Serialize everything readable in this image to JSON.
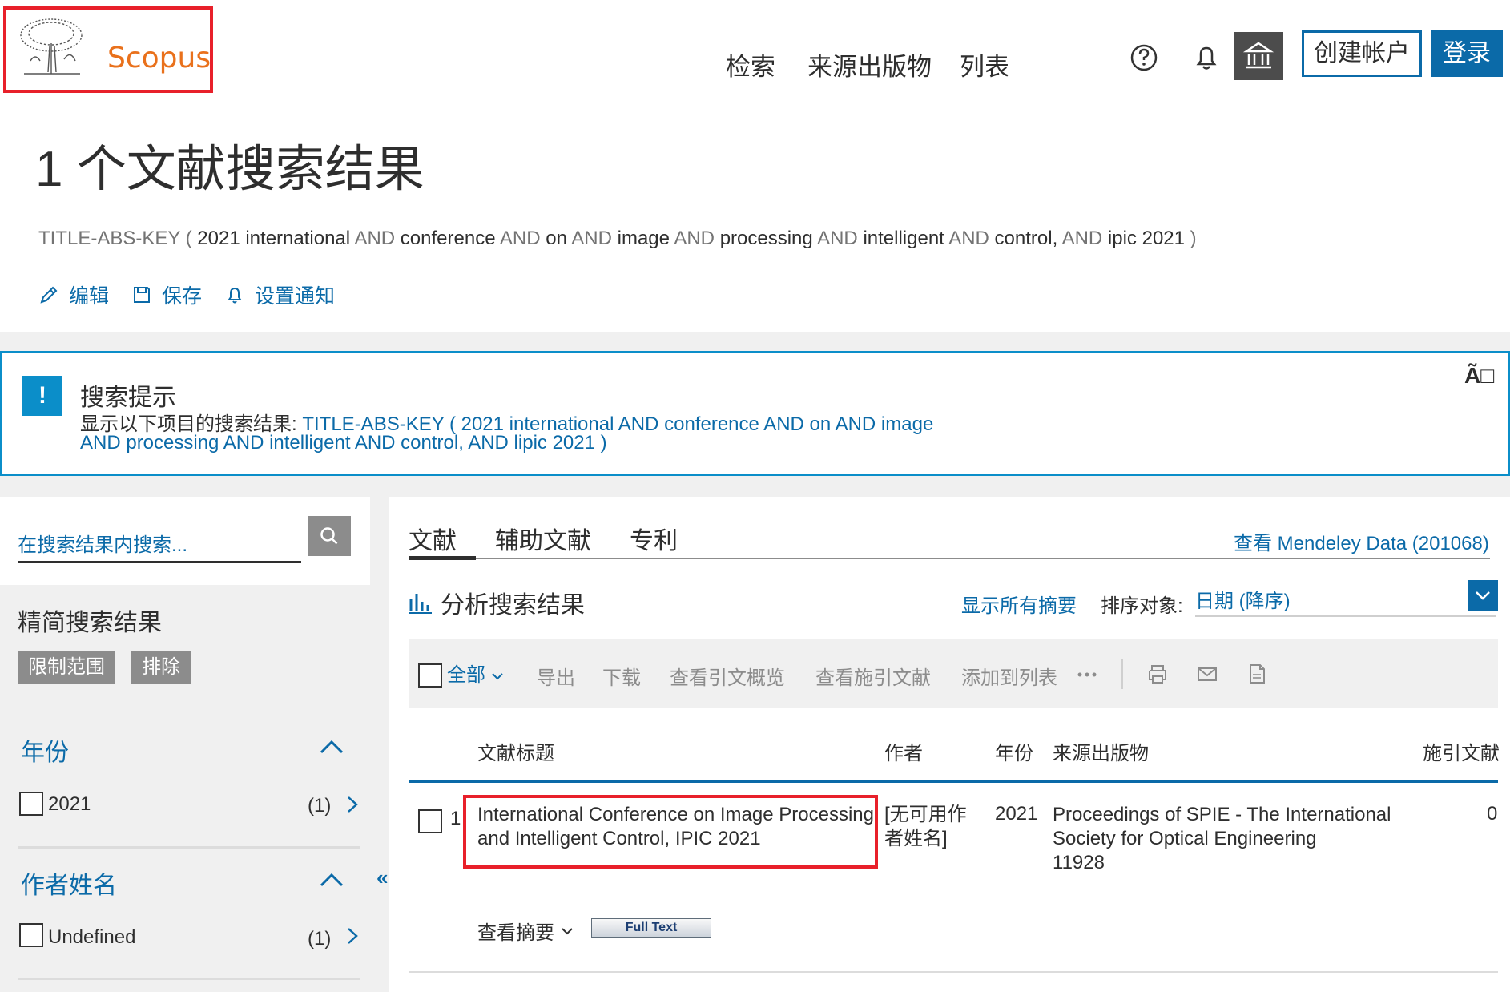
{
  "header": {
    "logo_text": "Scopus",
    "nav": [
      "检索",
      "来源出版物",
      "列表"
    ],
    "create_account": "创建帐户",
    "login": "登录"
  },
  "page_title": "1 个文献搜索结果",
  "query": {
    "prefix": "TITLE-ABS-KEY (",
    "parts": [
      {
        "t": "2021",
        "k": ""
      },
      {
        "t": "international",
        "k": ""
      },
      {
        "t": "conference",
        "k": "AND"
      },
      {
        "t": "on",
        "k": "AND"
      },
      {
        "t": "image",
        "k": "AND"
      },
      {
        "t": "processing",
        "k": "AND"
      },
      {
        "t": "intelligent",
        "k": "AND"
      },
      {
        "t": "control,",
        "k": "AND"
      },
      {
        "t": "ipic",
        "k": "AND"
      },
      {
        "t": "2021",
        "k": ""
      }
    ],
    "suffix": ")"
  },
  "actions": {
    "edit": "编辑",
    "save": "保存",
    "alert": "设置通知"
  },
  "tip": {
    "title": "搜索提示",
    "label": "显示以下项目的搜索结果:",
    "query_line1": "TITLE-ABS-KEY ( 2021  international  AND conference  AND on  AND image",
    "query_line2": "AND processing  AND  intelligent  AND control,  AND lipic  2021 )",
    "close": "Ã□"
  },
  "sidebar": {
    "search_placeholder": "在搜索结果内搜索...",
    "refine_title": "精简搜索结果",
    "limit": "限制范围",
    "exclude": "排除",
    "facets": [
      {
        "title": "年份",
        "item": "2021",
        "count": "(1)"
      },
      {
        "title": "作者姓名",
        "item": "Undefined",
        "count": "(1)"
      }
    ]
  },
  "main": {
    "tabs": [
      "文献",
      "辅助文献",
      "专利"
    ],
    "mendeley": "查看 Mendeley Data (201068)",
    "analyze": "分析搜索结果",
    "show_abstracts": "显示所有摘要",
    "sort_label": "排序对象:",
    "sort_value": "日期 (降序)",
    "toolbar": {
      "all": "全部",
      "items": [
        "导出",
        "下载",
        "查看引文概览",
        "查看施引文献",
        "添加到列表"
      ]
    },
    "columns": [
      "文献标题",
      "作者",
      "年份",
      "来源出版物",
      "施引文献"
    ],
    "row": {
      "num": "1",
      "title": "International Conference on Image Processing and Intelligent Control, IPIC 2021",
      "author": "[无可用作者姓名]",
      "year": "2021",
      "source_line1": "Proceedings of SPIE - The International Society for Optical Engineering",
      "source_line2": "11928",
      "cites": "0"
    },
    "view_abstract": "查看摘要",
    "full_text": "Full Text"
  }
}
